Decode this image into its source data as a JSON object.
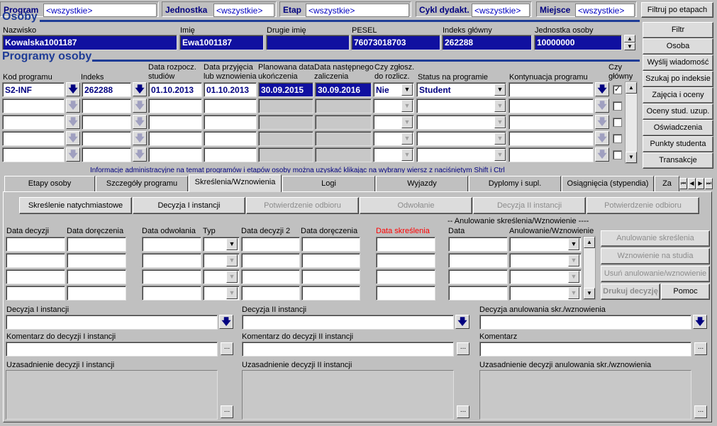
{
  "filter_bar": {
    "program_label": "Program",
    "program_value": "<wszystkie>",
    "unit_label": "Jednostka",
    "unit_value": "<wszystkie>",
    "stage_label": "Etap",
    "stage_value": "<wszystkie>",
    "cycle_label": "Cykl dydakt.",
    "cycle_value": "<wszystkie>",
    "place_label": "Miejsce",
    "place_value": "<wszystkie>",
    "filter_stages_button": "Filtruj po etapach"
  },
  "persons": {
    "title": "Osoby",
    "labels": {
      "surname": "Nazwisko",
      "first_name": "Imię",
      "second_name": "Drugie imię",
      "pesel": "PESEL",
      "main_index": "Indeks główny",
      "unit": "Jednostka osoby"
    },
    "values": {
      "surname": "Kowalska1001187",
      "first_name": "Ewa1001187",
      "second_name": "",
      "pesel": "76073018703",
      "main_index": "262288",
      "unit": "10000000"
    }
  },
  "side_buttons": {
    "filter": "Filtr",
    "person": "Osoba",
    "send_message": "Wyślij wiadomość",
    "search_index": "Szukaj po indeksie",
    "classes_grades": "Zajęcia i oceny",
    "grades_ext": "Oceny stud. uzup.",
    "statements": "Oświadczenia",
    "points": "Punkty studenta",
    "transactions": "Transakcje"
  },
  "programs": {
    "title": "Programy osoby",
    "columns": {
      "code": "Kod programu",
      "index": "Indeks",
      "start_date": "Data rozpocz. studiów",
      "admission_date": "Data przyjęcia lub wznowienia",
      "planned_end": "Planowana data ukończenia",
      "next_pass": "Data następnego zaliczenia",
      "reported": "Czy zgłosz. do rozlicz.",
      "status": "Status na programie",
      "continuation": "Kontynuacja programu",
      "main": "Czy główny"
    },
    "row": {
      "code": "S2-INF",
      "index": "262288",
      "start_date": "01.10.2013",
      "admission_date": "01.10.2013",
      "planned_end": "30.09.2015",
      "next_pass": "30.09.2016",
      "reported": "Nie",
      "status": "Student",
      "continuation": "",
      "main_checked": "✓"
    },
    "info": "Informacje administracyjne na temat programów i etapów osoby można uzyskać klikając na wybrany wiersz z naciśniętym Shift i Ctrl"
  },
  "tabs": [
    "Etapy osoby",
    "Szczegóły programu",
    "Skreślenia/Wznowienia",
    "Logi",
    "Wyjazdy",
    "Dyplomy i supl.",
    "Osiągnięcia (stypendia)",
    "Za"
  ],
  "subtabs": {
    "immediate": "Skreślenie natychmiastowe",
    "decision1": "Decyzja I instancji",
    "confirm1": "Potwierdzenie odbioru",
    "appeal": "Odwołanie",
    "decision2": "Decyzja II instancji",
    "confirm2": "Potwierdzenie odbioru"
  },
  "removal": {
    "col_decision_date": "Data decyzji",
    "col_delivery_date": "Data doręczenia",
    "col_appeal_date": "Data odwołania",
    "col_type": "Typ",
    "col_decision_date2": "Data decyzji 2",
    "col_delivery_date2": "Data doręczenia",
    "col_removal_date": "Data skreślenia",
    "cancel_group_label": "-- Anulowanie skreślenia/Wznowienie ----",
    "col_date": "Data",
    "col_cancel_resume": "Anulowanie/Wznowienie",
    "removal_color": "#ff0000"
  },
  "removal_buttons": {
    "cancel_removal": "Anulowanie skreślenia",
    "resume_studies": "Wznowienie na studia",
    "delete_cancel": "Usuń anulowanie/wznowienie",
    "print_decision": "Drukuj decyzję",
    "help": "Pomoc"
  },
  "bottom": {
    "decision1_label": "Decyzja I instancji",
    "decision2_label": "Decyzja II instancji",
    "decision_cancel_label": "Decyzja anulowania skr./wznowienia",
    "comment1_label": "Komentarz do decyzji I instancji",
    "comment2_label": "Komentarz do decyzji II instancji",
    "comment_label": "Komentarz",
    "justification1_label": "Uzasadnienie decyzji I instancji",
    "justification2_label": "Uzasadnienie decyzji II instancji",
    "justification_cancel_label": "Uzasadnienie decyzji anulowania skr./wznowienia",
    "dots": "..."
  },
  "colors": {
    "accent": "#1e3c96",
    "selected_bg": "#1010a0"
  }
}
